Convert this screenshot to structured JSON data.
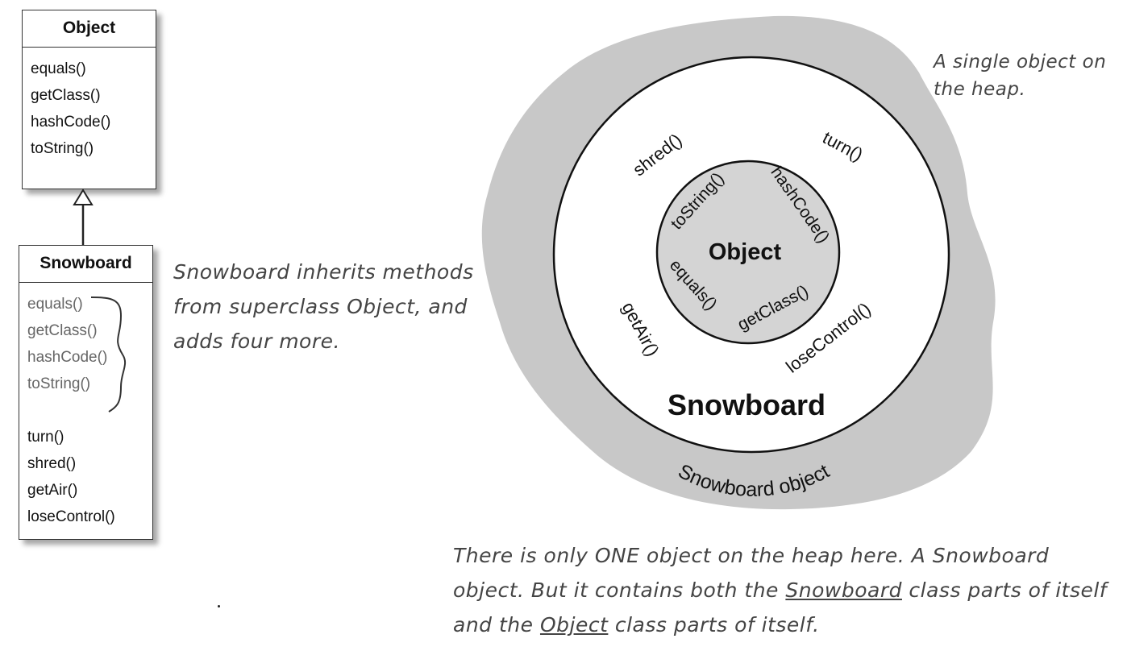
{
  "uml": {
    "object_class": {
      "name": "Object",
      "methods": [
        "equals()",
        "getClass()",
        "hashCode()",
        "toString()"
      ]
    },
    "snowboard_class": {
      "name": "Snowboard",
      "inherited_methods": [
        "equals()",
        "getClass()",
        "hashCode()",
        "toString()"
      ],
      "own_methods": [
        "turn()",
        "shred()",
        "getAir()",
        "loseControl()"
      ]
    }
  },
  "annotations": {
    "inherit_note": "Snowboard inherits methods from superclass Object, and adds four more.",
    "single_object_note": "A single object on the heap.",
    "bottom_note": {
      "part1": "There is only ONE object on the heap here. A Snowboard object. But it contains both the ",
      "snowboard_word": "Snowboard",
      "part2": " class parts of itself and the ",
      "object_word": "Object",
      "part3": " class parts of itself."
    }
  },
  "heap": {
    "outer_label": "Snowboard object",
    "snowboard_ring_label": "Snowboard",
    "object_core_label": "Object",
    "snowboard_methods": {
      "shred": "shred()",
      "turn": "turn()",
      "getAir": "getAir()",
      "loseControl": "loseControl()"
    },
    "object_methods": {
      "toString": "toString()",
      "hashCode": "hashCode()",
      "equals": "equals()",
      "getClass": "getClass()"
    }
  },
  "colors": {
    "heap_fill": "#c8c8c8",
    "core_fill": "#d4d4d4",
    "outline": "#111111",
    "note_text": "#444444"
  }
}
